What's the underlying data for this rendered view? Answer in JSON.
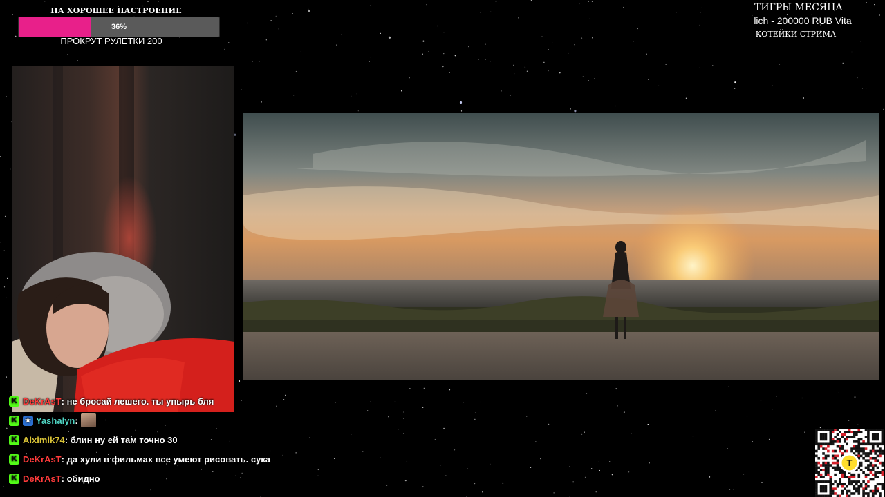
{
  "goal": {
    "title": "НА ХОРОШЕЕ НАСТРОЕНИЕ",
    "progress_percent": 36,
    "progress_label": "36%",
    "subtitle": "ПРОКРУТ РУЛЕТКИ 200",
    "fill_color": "#e8208a"
  },
  "tigers": {
    "title": "ТИГРЫ МЕСЯЦА",
    "entry": "lich - 200000 RUB  Vita",
    "subtitle": "КОТЕЙКИ СТРИМА"
  },
  "chat": {
    "messages": [
      {
        "user": "DeKrAsT",
        "user_color": "#ff3b3b",
        "text": ": не бросай лешего. ты упырь бля",
        "badges": [
          "kick-icon"
        ]
      },
      {
        "user": "Yashalyn",
        "user_color": "#4fd6c5",
        "text": ":",
        "badges": [
          "kick-icon",
          "star-icon"
        ],
        "emote": true
      },
      {
        "user": "Alximik74",
        "user_color": "#d8c236",
        "text": ": блин ну ей там точно 30",
        "badges": [
          "kick-icon"
        ]
      },
      {
        "user": "DeKrAsT",
        "user_color": "#ff3b3b",
        "text": ": да хули в фильмах все умеют рисовать. сука",
        "badges": [
          "kick-icon"
        ]
      },
      {
        "user": "DeKrAsT",
        "user_color": "#ff3b3b",
        "text": ": обидно",
        "badges": [
          "kick-icon"
        ]
      }
    ]
  },
  "icons": {
    "kick_badge": "K",
    "star_badge": "★",
    "qr_logo": "T"
  },
  "colors": {
    "kick_green": "#53fc18",
    "qr_logo_yellow": "#ffdd2d"
  }
}
